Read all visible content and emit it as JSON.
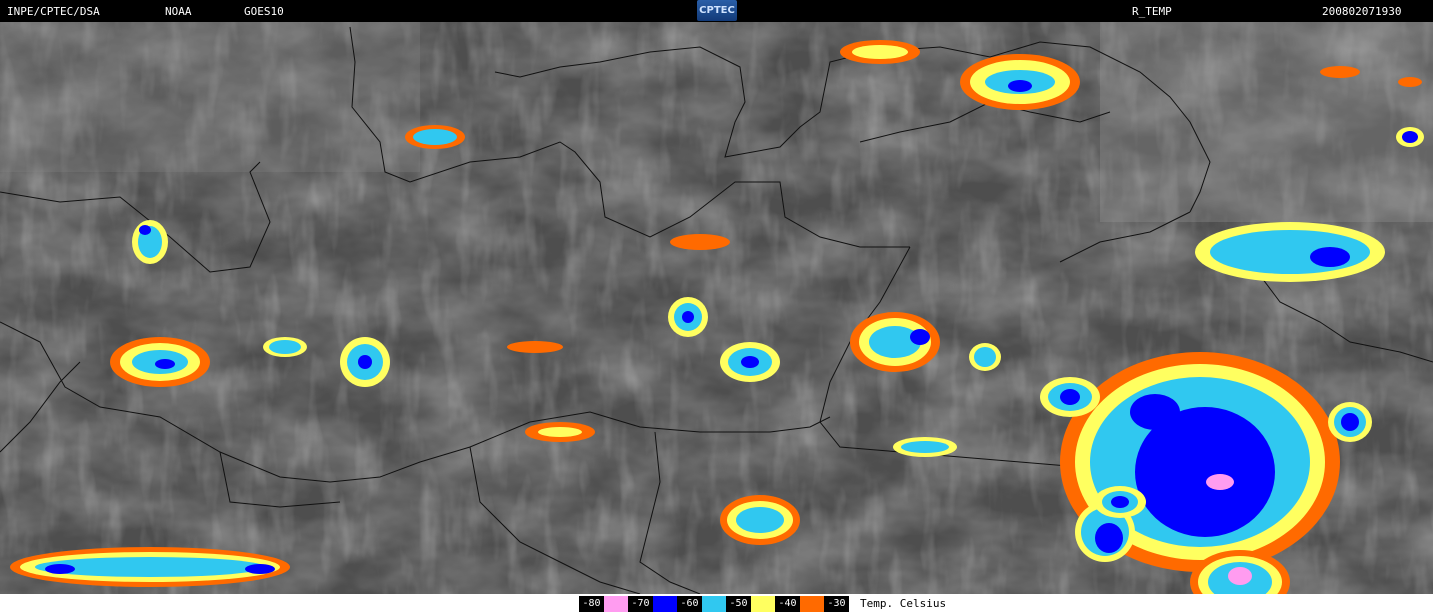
{
  "header": {
    "institution": "INPE/CPTEC/DSA",
    "agency": "NOAA",
    "satellite": "GOES10",
    "logo_text": "CPTEC",
    "product": "R_TEMP",
    "timestamp": "200802071930"
  },
  "legend": {
    "title": "Temp. Celsius",
    "items": [
      {
        "label": "-80",
        "color": "#ff9cf0"
      },
      {
        "label": "-70",
        "color": "#0000ff"
      },
      {
        "label": "-60",
        "color": "#30c8f0"
      },
      {
        "label": "-50",
        "color": "#ffff60"
      },
      {
        "label": "-40",
        "color": "#ff6a00"
      },
      {
        "label": "-30",
        "color": ""
      }
    ]
  }
}
